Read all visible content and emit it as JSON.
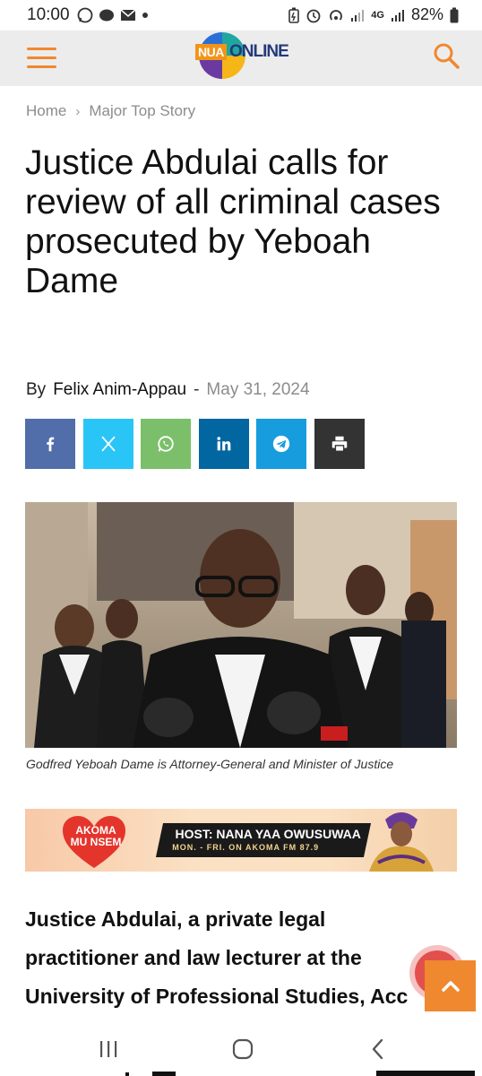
{
  "status_bar": {
    "time": "10:00",
    "network": "4G",
    "battery": "82%"
  },
  "header": {
    "logo_nua": "NUA",
    "logo_online": "ONLINE"
  },
  "breadcrumb": {
    "home": "Home",
    "separator": "›",
    "section": "Major Top Story"
  },
  "article": {
    "title": "Justice Abdulai calls for review of all criminal cases prosecuted by Yeboah Dame",
    "by": "By",
    "author": "Felix Anim-Appau",
    "dash": "-",
    "date": "May 31, 2024",
    "caption": "Godfred Yeboah Dame is Attorney-General and Minister of Justice",
    "lead": "Justice Abdulai, a private legal\npractitioner and law lecturer at the\nUniversity of Professional Studies, Acc"
  },
  "share": {
    "buttons": [
      {
        "name": "facebook",
        "color": "#516eab"
      },
      {
        "name": "x",
        "color": "#29c5f6"
      },
      {
        "name": "whatsapp",
        "color": "#7bbf6a"
      },
      {
        "name": "linkedin",
        "color": "#0266a0"
      },
      {
        "name": "telegram",
        "color": "#179cde"
      },
      {
        "name": "print",
        "color": "#333333"
      }
    ]
  },
  "ad": {
    "brand_line1": "AKOMA",
    "brand_line2": "MU NSEM",
    "host": "HOST: NANA YAA OWUSUWAA",
    "schedule": "MON. - FRI. ON AKOMA FM 87.9"
  },
  "colors": {
    "accent": "#f0882f",
    "header_bg": "#ececec",
    "bell": "#e2504e"
  }
}
